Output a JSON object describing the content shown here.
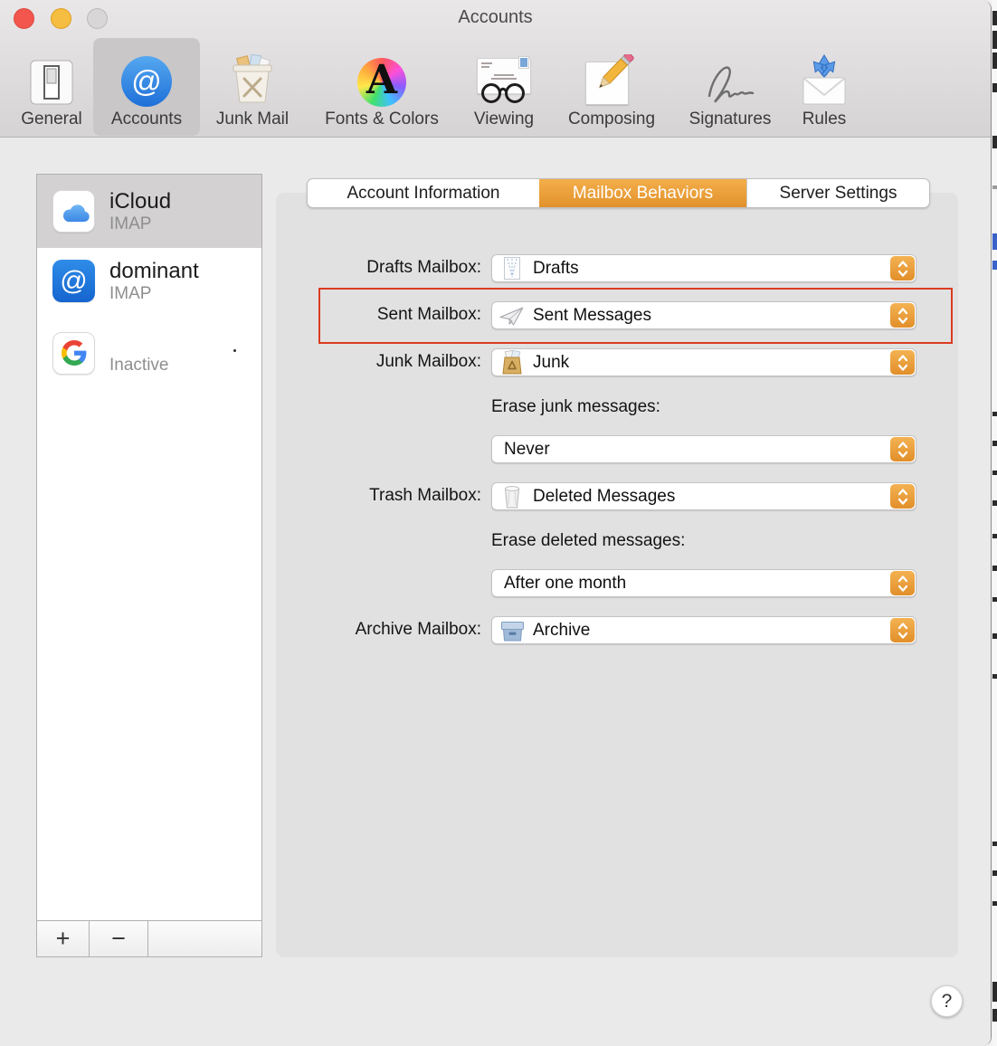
{
  "window": {
    "title": "Accounts"
  },
  "toolbar": {
    "selected": "Accounts",
    "items": [
      {
        "label": "General"
      },
      {
        "label": "Accounts"
      },
      {
        "label": "Junk Mail"
      },
      {
        "label": "Fonts & Colors"
      },
      {
        "label": "Viewing"
      },
      {
        "label": "Composing"
      },
      {
        "label": "Signatures"
      },
      {
        "label": "Rules"
      }
    ]
  },
  "sidebar": {
    "accounts": [
      {
        "name": "iCloud",
        "status": "IMAP",
        "selected": true
      },
      {
        "name": "dominant",
        "status": "IMAP",
        "selected": false
      },
      {
        "name": "",
        "status": "Inactive",
        "selected": false
      }
    ],
    "add_button": "+",
    "remove_button": "−"
  },
  "tabs": [
    {
      "label": "Account Information"
    },
    {
      "label": "Mailbox Behaviors"
    },
    {
      "label": "Server Settings"
    }
  ],
  "selected_tab": "Mailbox Behaviors",
  "form": {
    "drafts": {
      "label": "Drafts Mailbox:",
      "value": "Drafts"
    },
    "sent": {
      "label": "Sent Mailbox:",
      "value": "Sent Messages",
      "highlighted": true
    },
    "junk": {
      "label": "Junk Mailbox:",
      "value": "Junk"
    },
    "erase_junk": {
      "label": "Erase junk messages:",
      "value": "Never"
    },
    "trash": {
      "label": "Trash Mailbox:",
      "value": "Deleted Messages"
    },
    "erase_deleted": {
      "label": "Erase deleted messages:",
      "value": "After one month"
    },
    "archive": {
      "label": "Archive Mailbox:",
      "value": "Archive"
    }
  },
  "help_button": "?",
  "colors": {
    "accent_orange": "#e89b33",
    "annotation_red": "#dc3b20",
    "account_blue": "#1e6fd8",
    "selected_row_gray": "#d3d1d2"
  }
}
